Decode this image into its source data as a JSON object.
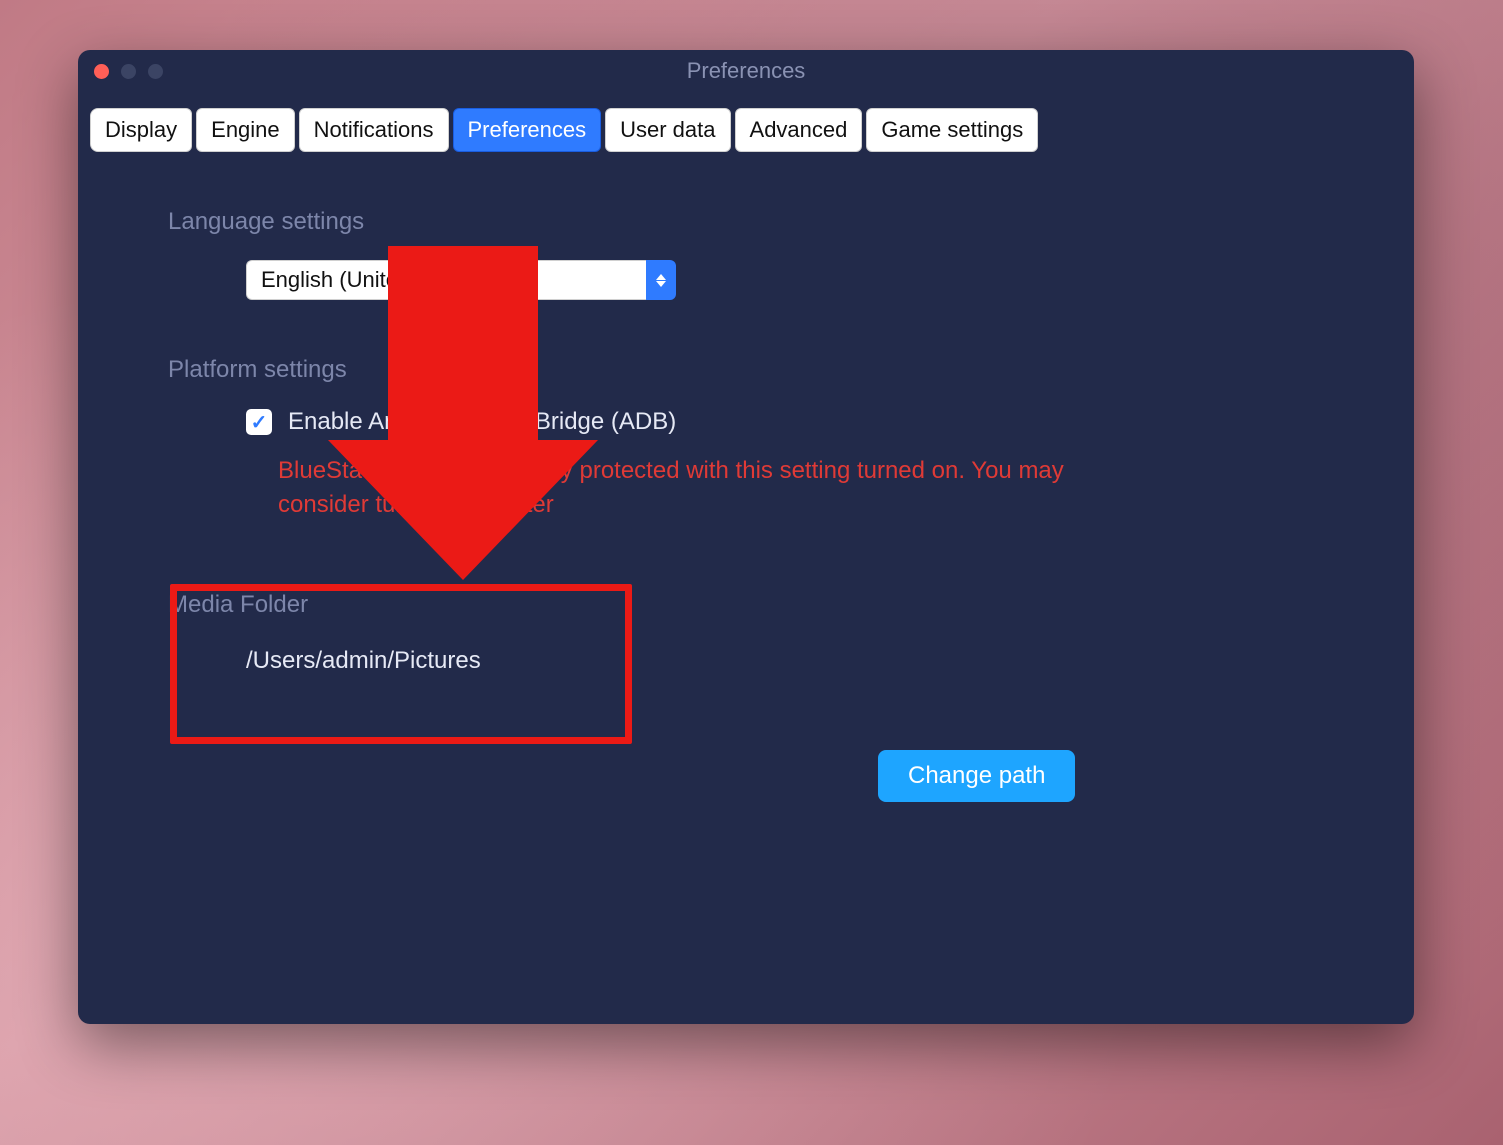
{
  "window": {
    "title": "Preferences"
  },
  "tabs": {
    "items": [
      {
        "label": "Display"
      },
      {
        "label": "Engine"
      },
      {
        "label": "Notifications"
      },
      {
        "label": "Preferences",
        "active": true
      },
      {
        "label": "User data"
      },
      {
        "label": "Advanced"
      },
      {
        "label": "Game settings"
      }
    ]
  },
  "language": {
    "section_label": "Language settings",
    "selected": "English (United States)"
  },
  "platform": {
    "section_label": "Platform settings",
    "adb_label": "Enable Android Debug Bridge (ADB)",
    "adb_checked": true,
    "warning": "BlueStacks may not be fully protected with this setting turned on. You may consider turning it off later"
  },
  "media": {
    "section_label": "Media Folder",
    "path": "/Users/admin/Pictures",
    "change_btn": "Change path"
  },
  "annotation": {
    "arrow_color": "#eb1a16",
    "highlight_target": "media-folder"
  }
}
